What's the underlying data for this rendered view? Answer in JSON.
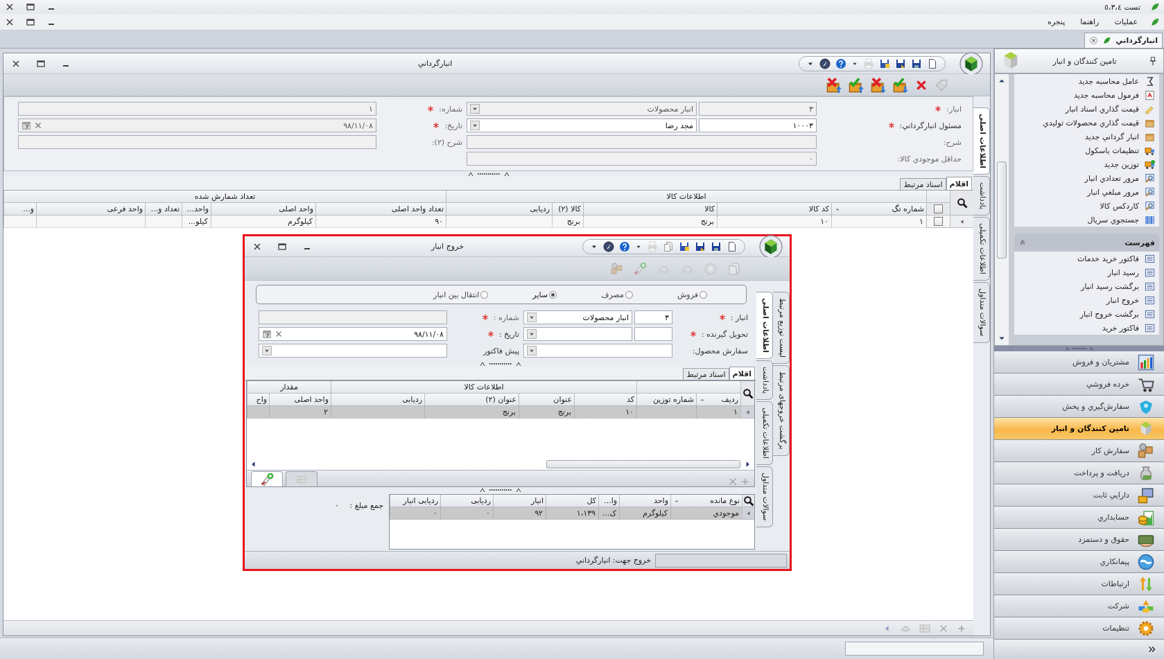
{
  "app": {
    "title": "تست ٥،٣،٤"
  },
  "menu": [
    {
      "label": "عملیات"
    },
    {
      "label": "راهنما"
    },
    {
      "label": "پنجره"
    }
  ],
  "doc_tabs": [
    {
      "label": "انبارگرداني",
      "selected": true
    }
  ],
  "main_window": {
    "title": "انبارگرداني",
    "side_tabs": [
      {
        "label": "اطلاعات اصلی",
        "selected": true
      },
      {
        "label": "یادداشت",
        "selected": false
      },
      {
        "label": "اطلاعات تکمیلی",
        "selected": false
      },
      {
        "label": "سوالات متداول",
        "selected": false
      }
    ],
    "fields_right": [
      {
        "kind": "lookup",
        "label": "انبار:",
        "required": true,
        "disabled": true,
        "code": "٣",
        "value": "انبار محصولات"
      },
      {
        "kind": "lookup",
        "label": "مسئول انبارگرداني:",
        "required": true,
        "disabled": false,
        "code": "١٠٠٠٣",
        "value": "مجد رضا"
      },
      {
        "kind": "text",
        "label": "شرح:",
        "required": false,
        "disabled": true
      },
      {
        "kind": "number",
        "label": "حداقل موجودي کالا:",
        "required": false,
        "disabled": true,
        "value": "٠"
      }
    ],
    "fields_left": [
      {
        "kind": "text",
        "label": "شماره:",
        "required": true,
        "disabled": true,
        "value": "١"
      },
      {
        "kind": "date",
        "label": "تاریخ:",
        "required": true,
        "disabled": true,
        "value": "٩٨/١١/٠٨"
      },
      {
        "kind": "text",
        "label": "شرح (٢):",
        "required": false,
        "disabled": true
      }
    ],
    "tabs": [
      {
        "label": "اقلام",
        "selected": true
      },
      {
        "label": "اسناد مرتبط",
        "selected": false
      }
    ],
    "grid": {
      "groups": [
        "اطلاعات کالا",
        "تعداد شمارش شده"
      ],
      "select_all": {
        "checked": false
      },
      "columns": [
        {
          "label": "شماره تگ",
          "sorted": true
        },
        {
          "label": "کد کالا",
          "sorted": false
        },
        {
          "label": "کالا",
          "sorted": false
        },
        {
          "label": "کالا (٢)",
          "sorted": false
        },
        {
          "label": "ردیابی",
          "sorted": false
        },
        {
          "label": "تعداد واحد اصلی",
          "sorted": false
        },
        {
          "label": "واحد اصلی",
          "sorted": false
        },
        {
          "label": "واحد...",
          "sorted": false
        },
        {
          "label": "تعداد و...",
          "sorted": false
        },
        {
          "label": "واحد فرعی",
          "sorted": false
        },
        {
          "label": "و...",
          "sorted": false
        }
      ],
      "rows": [
        {
          "selected": false,
          "checked": false,
          "cells": [
            "١",
            "١٠",
            "برنج",
            "برنج",
            null,
            "٩٠",
            "کیلوگرم",
            "کیلو...",
            null,
            null,
            null
          ]
        }
      ]
    }
  },
  "dialog": {
    "title": "خروج انبار",
    "side_tabs_outer": [
      {
        "label": "لیست توزیع مرتبط",
        "selected": false
      },
      {
        "label": "برگشت خروجهای مرتبط",
        "selected": false
      }
    ],
    "side_tabs": [
      {
        "label": "اطلاعات اصلی",
        "selected": true
      },
      {
        "label": "یادداشت",
        "selected": false
      },
      {
        "label": "اطلاعات تکمیلی",
        "selected": false
      },
      {
        "label": "سوالات متداول",
        "selected": false
      }
    ],
    "radios": [
      {
        "label": "فروش",
        "selected": false
      },
      {
        "label": "مصرف",
        "selected": false
      },
      {
        "label": "سایر",
        "selected": true
      },
      {
        "label": "انتقال بین انبار",
        "selected": false
      }
    ],
    "fields": [
      {
        "kind": "lookup",
        "label": "انبار :",
        "required": true,
        "disabled": false,
        "code": "٣",
        "value": "انبار محصولات"
      },
      {
        "kind": "text",
        "label": "شماره :",
        "required": true,
        "disabled": true
      },
      {
        "kind": "lookup",
        "label": "تحویل گیرنده :",
        "required": true,
        "disabled": false
      },
      {
        "kind": "date",
        "label": "تاریخ :",
        "required": true,
        "disabled": false,
        "value": "٩٨/١١/٠٨"
      },
      {
        "kind": "combo",
        "label": "سفارش محصول:",
        "required": false,
        "disabled": false
      },
      {
        "kind": "combo",
        "label": "پیش فاکتور",
        "required": false,
        "disabled": false
      }
    ],
    "tabs": [
      {
        "label": "اقلام",
        "selected": true
      },
      {
        "label": "اسناد مرتبط",
        "selected": false
      }
    ],
    "grid": {
      "groups": [
        "اطلاعات کالا",
        "مقدار"
      ],
      "columns": [
        {
          "label": "ردیف",
          "sorted": true
        },
        {
          "label": "شماره توزین",
          "sorted": false
        },
        {
          "label": "کد",
          "sorted": false
        },
        {
          "label": "عنوان",
          "sorted": false
        },
        {
          "label": "عنوان (٢)",
          "sorted": false
        },
        {
          "label": "ردیابی",
          "sorted": false
        },
        {
          "label": "واحد اصلی",
          "sorted": false
        },
        {
          "label": "واح",
          "sorted": false
        }
      ],
      "rows": [
        {
          "selected": true,
          "cells": [
            "١",
            null,
            "١٠",
            "برنج",
            "برنج",
            null,
            "٢",
            null
          ]
        }
      ]
    },
    "stock_grid": {
      "columns": [
        {
          "label": "نوع مانده",
          "sorted": true
        },
        {
          "label": "واحد",
          "sorted": false
        },
        {
          "label": "وا...",
          "sorted": false
        },
        {
          "label": "کل",
          "sorted": false
        },
        {
          "label": "انبار",
          "sorted": false
        },
        {
          "label": "ردیابی",
          "sorted": false
        },
        {
          "label": "ردیابی انبار",
          "sorted": false
        }
      ],
      "rows": [
        {
          "selected": true,
          "cells": [
            "موجودي",
            "کیلوگرم",
            "ک...",
            "١،١٣٩",
            "٩٢",
            "٠",
            "٠"
          ]
        }
      ]
    },
    "total": {
      "label": "جمع مبلغ :",
      "value": "٠"
    },
    "status": "خروج جهت: انبارگرداني"
  },
  "sidebar": {
    "title": "تامین کنندگان و انبار",
    "items": [
      {
        "label": "عامل محاسبه جدید"
      },
      {
        "label": "فرمول محاسبه جدید"
      },
      {
        "label": "قیمت گذاري اسناد انبار"
      },
      {
        "label": "قیمت گذاري محصولات تولیدي"
      },
      {
        "label": "انبار گرداني جدید"
      },
      {
        "label": "تنظیمات باسکول"
      },
      {
        "label": "توزین جدید"
      },
      {
        "label": "مرور تعدادي انبار"
      },
      {
        "label": "مرور مبلغي انبار"
      },
      {
        "label": "کاردکس کالا"
      },
      {
        "label": "جستجوي سریال"
      }
    ],
    "section": {
      "title": "فهرست",
      "expanded": true,
      "items": [
        {
          "label": "فاکتور خرید خدمات"
        },
        {
          "label": "رسید انبار"
        },
        {
          "label": "برگشت رسید انبار"
        },
        {
          "label": "خروج انبار"
        },
        {
          "label": "برگشت خروج انبار"
        },
        {
          "label": "فاکتور خرید"
        }
      ]
    },
    "modules": [
      {
        "label": "مشتریان و فروش",
        "selected": false
      },
      {
        "label": "خرده فروشي",
        "selected": false
      },
      {
        "label": "سفارش‌گيري و پخش",
        "selected": false
      },
      {
        "label": "تامین کنندگان و انبار",
        "selected": true
      },
      {
        "label": "سفارش کار",
        "selected": false
      },
      {
        "label": "دریافت و پرداخت",
        "selected": false
      },
      {
        "label": "دارايي ثابت",
        "selected": false
      },
      {
        "label": "حسابداري",
        "selected": false
      },
      {
        "label": "حقوق و دستمزد",
        "selected": false
      },
      {
        "label": "پيمانکاري",
        "selected": false
      },
      {
        "label": "ارتباطات",
        "selected": false
      },
      {
        "label": "شرکت",
        "selected": false
      },
      {
        "label": "تنظیمات",
        "selected": false
      }
    ]
  }
}
